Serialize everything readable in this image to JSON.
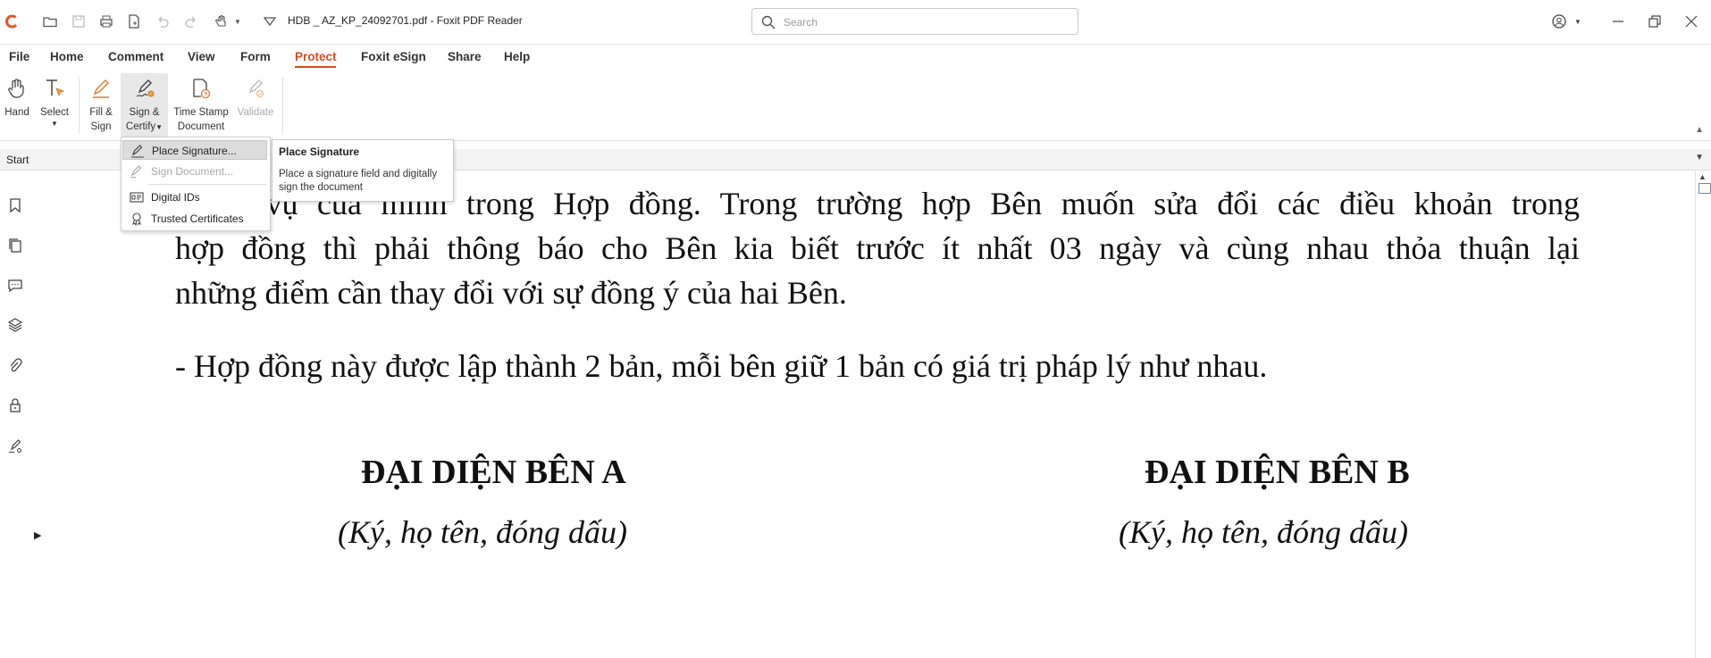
{
  "window": {
    "title": "HDB _ AZ_KP_24092701.pdf - Foxit PDF Reader",
    "search_placeholder": "Search"
  },
  "menu": [
    "File",
    "Home",
    "Comment",
    "View",
    "Form",
    "Protect",
    "Foxit eSign",
    "Share",
    "Help"
  ],
  "active_menu": "Protect",
  "ribbon": {
    "hand": "Hand",
    "select": "Select",
    "fill_sign_1": "Fill &",
    "fill_sign_2": "Sign",
    "sign_certify_1": "Sign &",
    "sign_certify_2": "Certify",
    "timestamp_1": "Time Stamp",
    "timestamp_2": "Document",
    "validate": "Validate"
  },
  "tabs": {
    "start": "Start"
  },
  "dropdown": {
    "items": [
      "Place Signature...",
      "Sign Document...",
      "Digital IDs",
      "Trusted Certificates"
    ]
  },
  "tooltip": {
    "title": "Place Signature",
    "description": "Place a signature field and digitally sign the document"
  },
  "document": {
    "line_partial": "nghĩa vụ của mình trong Hợp đồng. Trong trường hợp Bên muốn sửa đổi các điều khoản trong",
    "line2": "hợp đồng thì phải thông báo cho Bên kia biết trước ít nhất 03 ngày và cùng nhau thỏa thuận lại",
    "line3": "những điểm cần thay đổi với sự đồng ý của hai Bên.",
    "line4": "- Hợp đồng này được lập thành 2 bản, mỗi bên giữ 1 bản có giá trị pháp lý như nhau.",
    "party_a": "ĐẠI DIỆN BÊN A",
    "party_b": "ĐẠI DIỆN BÊN B",
    "sign_note_a": "(Ký, họ tên, đóng dấu)",
    "sign_note_b": "(Ký, họ tên, đóng dấu)"
  },
  "colors": {
    "accent": "#d24d1e"
  }
}
